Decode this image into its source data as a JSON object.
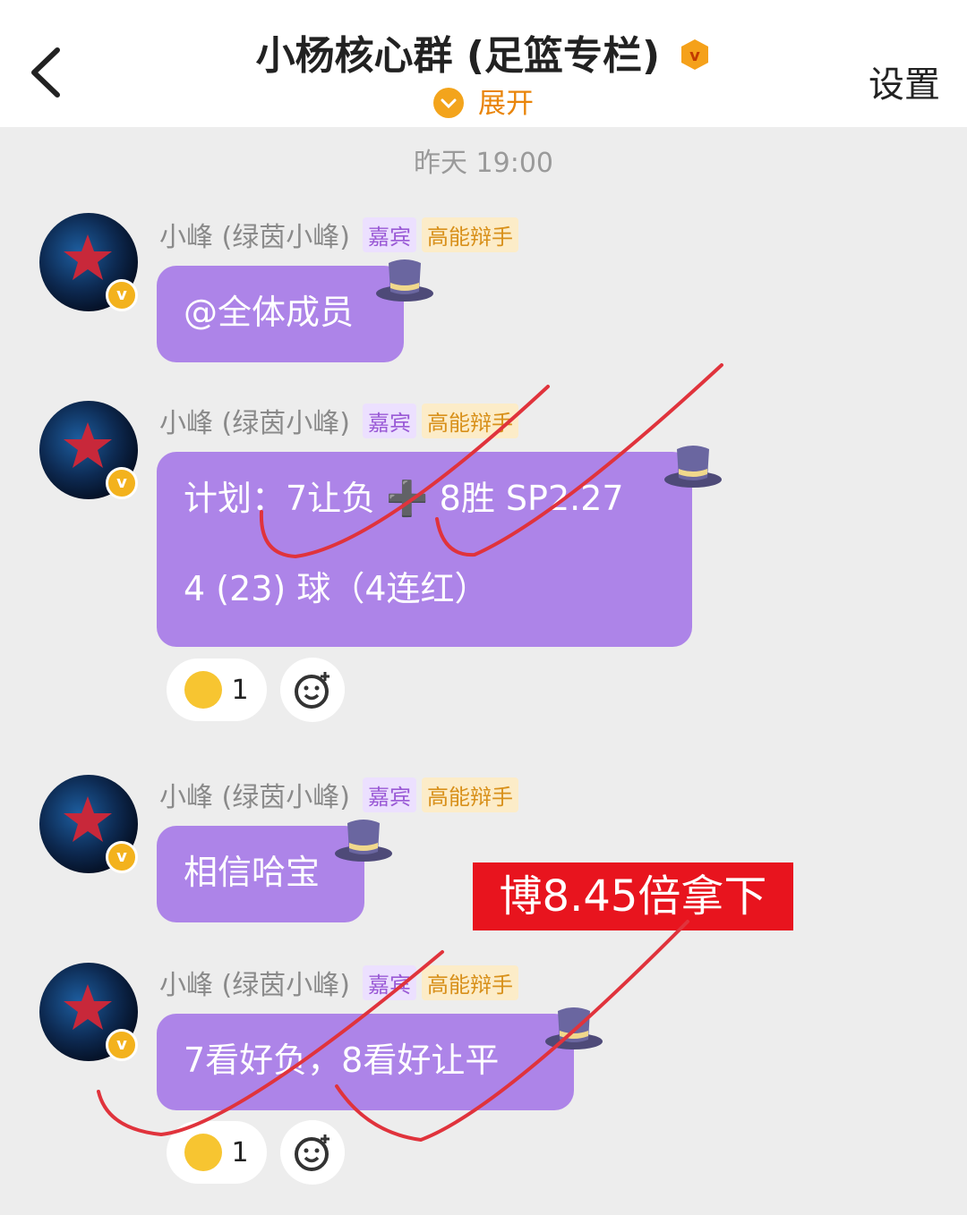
{
  "header": {
    "back_icon": "chevron-left-icon",
    "title": "小杨核心群 (足篮专栏)",
    "badge_icon": "verified-v-icon",
    "expand_label": "展开",
    "settings_label": "设置"
  },
  "timestamp": "昨天 19:00",
  "sender": {
    "name": "小峰 (绿茵小峰)",
    "tags": [
      "嘉宾",
      "高能辩手"
    ],
    "verify_glyph": "v"
  },
  "messages": [
    {
      "lines": [
        "@全体成员"
      ]
    },
    {
      "lines": [
        "计划：7让负 ➕ 8胜 SP2.27",
        "4 (23) 球（4连红）"
      ]
    },
    {
      "lines": [
        "相信哈宝"
      ]
    },
    {
      "lines": [
        "7看好负，8看好让平"
      ]
    }
  ],
  "reactions": [
    {
      "emoji": "flower-smile-emoji",
      "count": "1"
    },
    {
      "emoji": "flower-smile-emoji",
      "count": "1"
    }
  ],
  "stamp_text": "博8.45倍拿下",
  "colors": {
    "bubble": "#ad84e8",
    "accent_orange": "#e9850a",
    "stamp_red": "#e8141e",
    "check_mark": "#e0333c"
  }
}
